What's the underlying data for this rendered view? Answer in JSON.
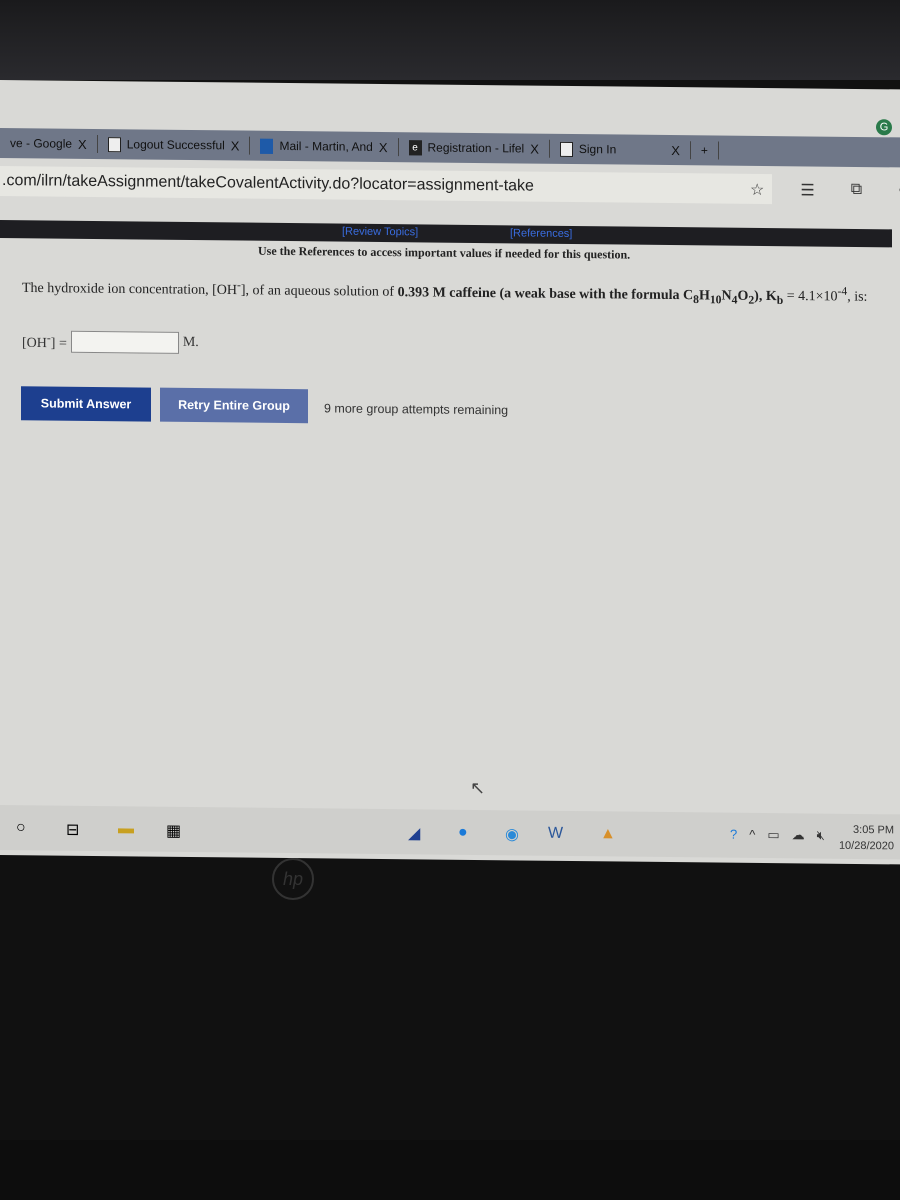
{
  "browser": {
    "tabs": [
      {
        "label": "ve - Google",
        "icon": "google-drive-icon"
      },
      {
        "label": "Logout Successful",
        "icon": "page-icon"
      },
      {
        "label": "Mail - Martin, And",
        "icon": "outlook-icon"
      },
      {
        "label": "Registration - Lifel",
        "icon": "e-icon"
      },
      {
        "label": "Sign In",
        "icon": "page-icon"
      }
    ],
    "close_symbol": "X",
    "new_tab": "+",
    "url": ".com/ilrn/takeAssignment/takeCovalentActivity.do?locator=assignment-take",
    "profile_letter": "G"
  },
  "page": {
    "review_topics": "[Review Topics]",
    "references": "[References]",
    "ref_note": "Use the References to access important values if needed for this question.",
    "question_a": "The hydroxide ion concentration, [OH",
    "question_b": "], of an aqueous solution of ",
    "question_c": "0.393 M caffeine (a weak base with the formula C",
    "question_d": "), K",
    "question_e": " = 4.1×10",
    "question_f": ", is:",
    "answer_label": "[OH",
    "answer_label_end": "] =",
    "answer_value": "",
    "unit": "M.",
    "submit": "Submit Answer",
    "retry": "Retry Entire Group",
    "attempts": "9 more group attempts remaining"
  },
  "taskbar": {
    "time": "3:05 PM",
    "date": "10/28/2020"
  },
  "colors": {
    "submit": "#1d3f8f",
    "retry": "#5a6fa8",
    "link": "#3a6de0"
  }
}
